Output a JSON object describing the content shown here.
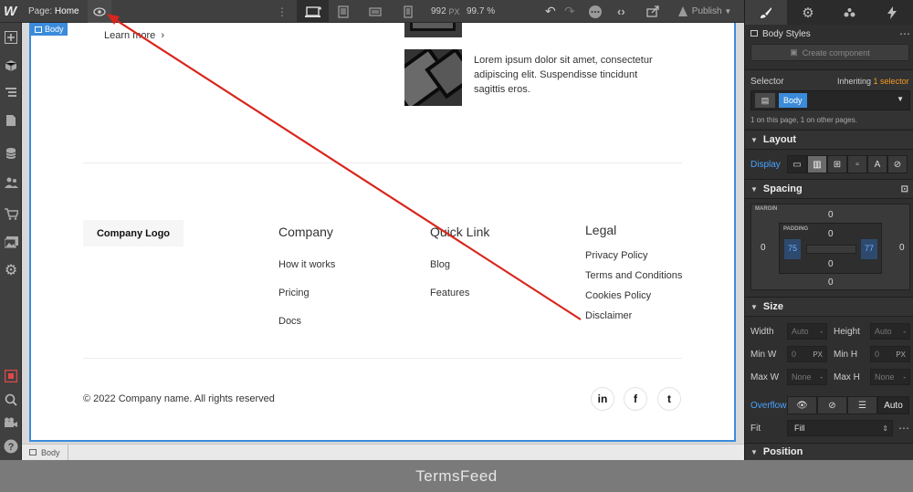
{
  "topbar": {
    "page_label": "Page:",
    "page_name": "Home",
    "width_value": "992",
    "width_unit": "PX",
    "zoom": "99.7 %",
    "publish_label": "Publish"
  },
  "canvas": {
    "body_tag": "Body",
    "learn_more": "Learn more",
    "lorem_text": "Lorem ipsum dolor sit amet, consectetur adipiscing elit. Suspendisse tincidunt sagittis eros.",
    "company_logo": "Company Logo",
    "columns": [
      {
        "heading": "Company",
        "links": [
          "How it works",
          "Pricing",
          "Docs"
        ]
      },
      {
        "heading": "Quick Link",
        "links": [
          "Blog",
          "Features"
        ]
      },
      {
        "heading": "Legal",
        "links": [
          "Privacy Policy",
          "Terms and Conditions",
          "Cookies Policy",
          "Disclaimer"
        ]
      }
    ],
    "copyright": "© 2022 Company name. All rights reserved",
    "social": [
      "in",
      "f",
      "t"
    ]
  },
  "statusbar": {
    "breadcrumb": "Body"
  },
  "panel": {
    "body_styles": "Body Styles",
    "create_component": "Create component",
    "selector_label": "Selector",
    "inheriting": "Inheriting",
    "inherit_count": "1 selector",
    "selector_tag": "Body",
    "selector_note": "1 on this page, 1 on other pages.",
    "layout_title": "Layout",
    "display_label": "Display",
    "spacing_title": "Spacing",
    "margin_label": "MARGIN",
    "padding_label": "PADDING",
    "margin": {
      "top": "0",
      "right": "0",
      "bottom": "0",
      "left": "0"
    },
    "padding": {
      "top": "0",
      "right": "77",
      "bottom": "0",
      "left": "75"
    },
    "size_title": "Size",
    "width_label": "Width",
    "height_label": "Height",
    "minw_label": "Min W",
    "minh_label": "Min H",
    "maxw_label": "Max W",
    "maxh_label": "Max H",
    "auto": "Auto",
    "zero": "0",
    "none": "None",
    "px": "PX",
    "overflow_label": "Overflow",
    "overflow_auto": "Auto",
    "fit_label": "Fit",
    "fit_value": "Fill",
    "position_title": "Position"
  },
  "banner": "TermsFeed",
  "colors": {
    "accent": "#3b8bdb",
    "annotation": "#d9261c",
    "orange": "#f59a23"
  }
}
